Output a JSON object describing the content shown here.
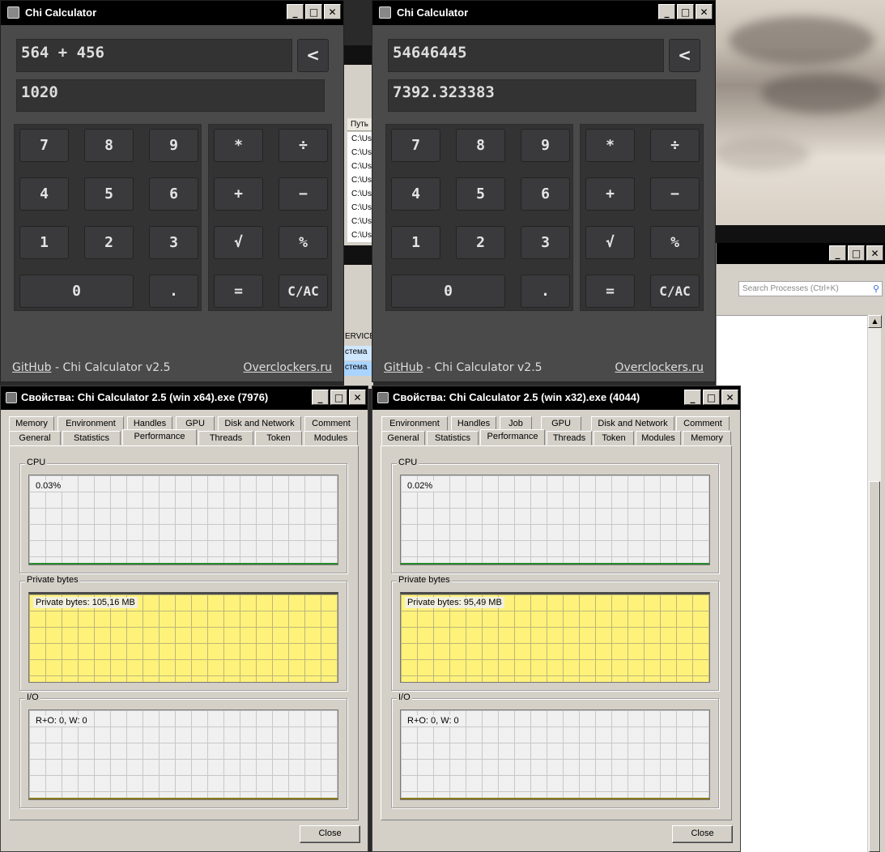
{
  "calculators": [
    {
      "title": "Chi Calculator",
      "expression": "564 + 456",
      "result": "1020",
      "backspace_label": "<",
      "footer": {
        "github": "GitHub",
        "version_text": " - Chi Calculator v2.5",
        "site": "Overclockers.ru"
      }
    },
    {
      "title": "Chi Calculator",
      "expression": "54646445",
      "result": "7392.323383",
      "backspace_label": "<",
      "footer": {
        "github": "GitHub",
        "version_text": " - Chi Calculator v2.5",
        "site": "Overclockers.ru"
      }
    }
  ],
  "keypad": {
    "k7": "7",
    "k8": "8",
    "k9": "9",
    "k4": "4",
    "k5": "5",
    "k6": "6",
    "k1": "1",
    "k2": "2",
    "k3": "3",
    "k0": "0",
    "dot": ".",
    "mul": "*",
    "div": "÷",
    "add": "+",
    "sub": "−",
    "sqrt": "√",
    "pct": "%",
    "eq": "=",
    "clear": "C/AC"
  },
  "window_buttons": {
    "minimize": "_",
    "maximize": "□",
    "close": "✕"
  },
  "process_explorer": {
    "search_placeholder": "Search Processes (Ctrl+K)",
    "path_header": "Путь",
    "path_rows": [
      "C:\\Us",
      "C:\\Us",
      "C:\\Us",
      "C:\\Us",
      "C:\\Us",
      "C:\\Us",
      "C:\\Us",
      "C:\\Us"
    ],
    "user_rows": [
      "ERVICE",
      "стема",
      "стема"
    ]
  },
  "properties": [
    {
      "title": "Свойства: Chi Calculator 2.5 (win x64).exe (7976)",
      "tabs_row1": [
        "Memory",
        "Environment",
        "Handles",
        "GPU",
        "Disk and Network",
        "Comment"
      ],
      "tabs_row2": [
        "General",
        "Statistics",
        "Performance",
        "Threads",
        "Token",
        "Modules"
      ],
      "cpu_label": "CPU",
      "cpu_value": "0.03%",
      "private_label": "Private bytes",
      "private_value": "Private bytes: 105,16 MB",
      "io_label": "I/O",
      "io_value": "R+O: 0, W: 0",
      "close_label": "Close"
    },
    {
      "title": "Свойства: Chi Calculator 2.5 (win x32).exe (4044)",
      "tabs_row1": [
        "Environment",
        "Handles",
        "Job",
        "GPU",
        "Disk and Network",
        "Comment"
      ],
      "tabs_row2": [
        "General",
        "Statistics",
        "Performance",
        "Threads",
        "Token",
        "Modules",
        "Memory"
      ],
      "cpu_label": "CPU",
      "cpu_value": "0.02%",
      "private_label": "Private bytes",
      "private_value": "Private bytes: 95,49 MB",
      "io_label": "I/O",
      "io_value": "R+O: 0, W: 0",
      "close_label": "Close"
    }
  ]
}
